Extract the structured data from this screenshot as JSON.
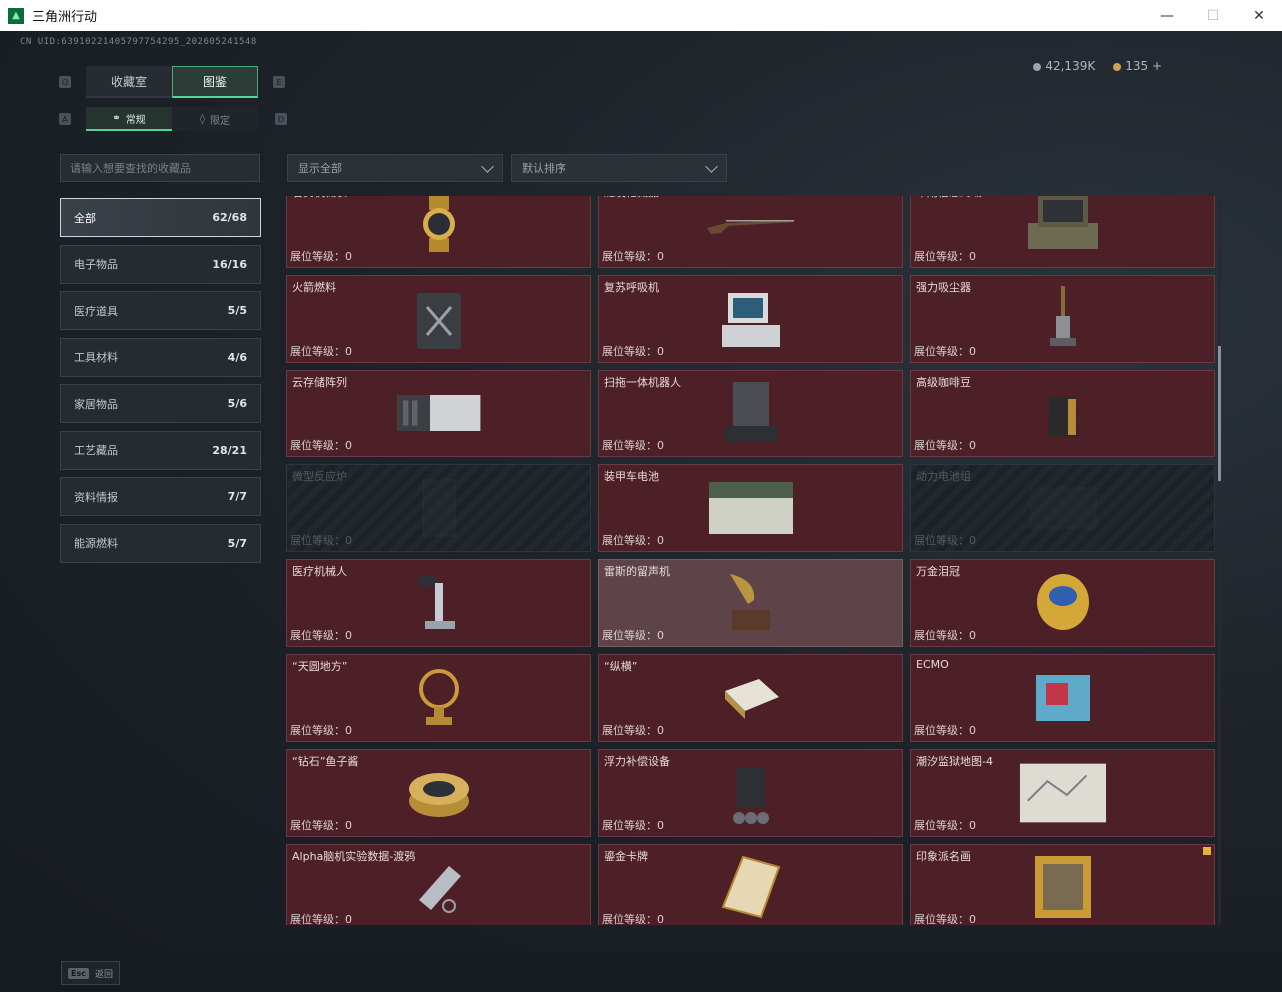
{
  "window": {
    "title": "三角洲行动"
  },
  "header": {
    "uid": "CN UID:6391022140579775429​5_202605241548",
    "silver_amount": "42,139K",
    "gold_amount": "135",
    "add_label": "+"
  },
  "tabs": [
    {
      "label": "收藏室"
    },
    {
      "label": "图鉴"
    }
  ],
  "tab_keys": {
    "left": "Q",
    "right": "E",
    "sub_left": "A",
    "sub_right": "D"
  },
  "subtabs": [
    {
      "label": "常规"
    },
    {
      "label": "限定"
    }
  ],
  "search": {
    "placeholder": "请输入想要查找的收藏品"
  },
  "filters": {
    "show": "显示全部",
    "sort": "默认排序"
  },
  "categories": [
    {
      "label": "全部",
      "count": "62/68"
    },
    {
      "label": "电子物品",
      "count": "16/16"
    },
    {
      "label": "医疗道具",
      "count": "5/5"
    },
    {
      "label": "工具材料",
      "count": "4/6"
    },
    {
      "label": "家居物品",
      "count": "5/6"
    },
    {
      "label": "工艺藏品",
      "count": "28/21"
    },
    {
      "label": "资料情报",
      "count": "7/7"
    },
    {
      "label": "能源燃料",
      "count": "5/7"
    }
  ],
  "level_label": "展位等级：0",
  "items": [
    {
      "name": "名贵机械表",
      "icon": "watch-icon"
    },
    {
      "name": "燧发枪藏品",
      "icon": "musket-icon"
    },
    {
      "name": "军用信息终端",
      "icon": "terminal-case-icon"
    },
    {
      "name": "火箭燃料",
      "icon": "fuel-can-icon"
    },
    {
      "name": "复苏呼吸机",
      "icon": "ventilator-icon"
    },
    {
      "name": "强力吸尘器",
      "icon": "vacuum-icon"
    },
    {
      "name": "云存储阵列",
      "icon": "storage-array-icon"
    },
    {
      "name": "扫拖一体机器人",
      "icon": "robot-vacuum-icon"
    },
    {
      "name": "高级咖啡豆",
      "icon": "coffee-bag-icon"
    },
    {
      "name": "微型反应炉",
      "icon": "reactor-icon",
      "locked": true
    },
    {
      "name": "装甲车电池",
      "icon": "battery-icon"
    },
    {
      "name": "动力电池组",
      "icon": "battery-pack-icon",
      "locked": true
    },
    {
      "name": "医疗机械人",
      "icon": "medical-robot-icon"
    },
    {
      "name": "雷斯的留声机",
      "icon": "gramophone-icon",
      "highlight": true
    },
    {
      "name": "万金泪冠",
      "icon": "jewel-egg-icon"
    },
    {
      "name": "“天圆地方”",
      "icon": "armillary-icon"
    },
    {
      "name": "“纵横”",
      "icon": "chessboard-icon"
    },
    {
      "name": "ECMO",
      "icon": "ecmo-icon"
    },
    {
      "name": "“钻石”鱼子酱",
      "icon": "caviar-tin-icon"
    },
    {
      "name": "浮力补偿设备",
      "icon": "diving-gear-icon"
    },
    {
      "name": "潮汐监狱地图-4",
      "icon": "map-sheet-icon"
    },
    {
      "name": "Alpha脑机实验数据-渡鸦",
      "icon": "data-drive-icon"
    },
    {
      "name": "鎏金卡牌",
      "icon": "gilded-card-icon"
    },
    {
      "name": "印象派名画",
      "icon": "framed-painting-icon",
      "badge": true
    }
  ],
  "footer": {
    "esc_key": "Esc",
    "esc_label": "返回"
  },
  "colors": {
    "accent": "#58d39a",
    "card_bg": "#4d1f27",
    "locked_bg": "#22282e",
    "highlight_bg": "#5e4448"
  }
}
